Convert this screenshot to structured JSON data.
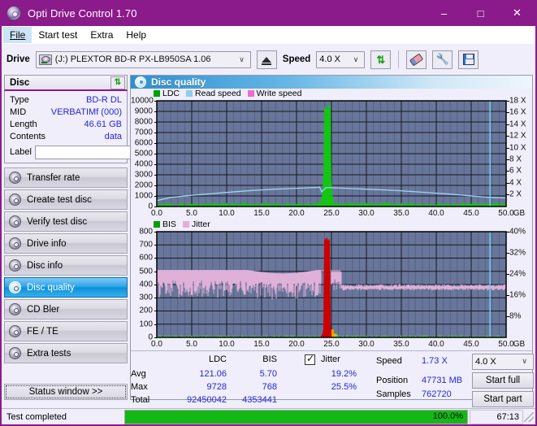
{
  "window": {
    "title": "Opti Drive Control 1.70",
    "icon": "disc-icon",
    "minimize": "–",
    "maximize": "□",
    "close": "✕"
  },
  "menu": [
    {
      "label": "File",
      "active": true
    },
    {
      "label": "Start test",
      "active": false
    },
    {
      "label": "Extra",
      "active": false
    },
    {
      "label": "Help",
      "active": false
    }
  ],
  "toolbar": {
    "drive_label": "Drive",
    "drive_value": "(J:)  PLEXTOR BD-R  PX-LB950SA 1.06",
    "drive_icon": "drive-icon",
    "eject_icon": "eject-icon",
    "speed_label": "Speed",
    "speed_value": "4.0 X",
    "refresh_icon": "refresh-icon",
    "eraser_icon": "eraser-icon",
    "tools_icon": "wrench-icon",
    "save_icon": "save-icon",
    "caret": "∨"
  },
  "disc_panel": {
    "title": "Disc",
    "refresh_icon": "refresh-icon",
    "rows": [
      {
        "key": "Type",
        "value": "BD-R DL"
      },
      {
        "key": "MID",
        "value": "VERBATIMf (000)"
      },
      {
        "key": "Length",
        "value": "46.61 GB"
      },
      {
        "key": "Contents",
        "value": "data"
      }
    ],
    "label_key": "Label",
    "label_value": "",
    "label_placeholder": "",
    "disc_icon": "cd-icon"
  },
  "nav": {
    "items": [
      {
        "label": "Transfer rate",
        "selected": false
      },
      {
        "label": "Create test disc",
        "selected": false
      },
      {
        "label": "Verify test disc",
        "selected": false
      },
      {
        "label": "Drive info",
        "selected": false
      },
      {
        "label": "Disc info",
        "selected": false
      },
      {
        "label": "Disc quality",
        "selected": true
      },
      {
        "label": "CD Bler",
        "selected": false
      },
      {
        "label": "FE / TE",
        "selected": false
      },
      {
        "label": "Extra tests",
        "selected": false
      }
    ],
    "status_window_button": "Status window >>"
  },
  "content": {
    "header_title": "Disc quality",
    "header_icon": "disc-quality-icon"
  },
  "chart_data": [
    {
      "type": "line",
      "name": "top-chart",
      "title": "",
      "xlabel": "GB",
      "ylabel": "",
      "xlim": [
        0,
        50
      ],
      "ylim": [
        0,
        10000
      ],
      "y2lim": [
        0,
        18
      ],
      "y2label": "X",
      "grid": true,
      "legend": [
        {
          "label": "LDC",
          "color": "#00a000"
        },
        {
          "label": "Read speed",
          "color": "#8ccfee"
        },
        {
          "label": "Write speed",
          "color": "#f06bd0"
        }
      ],
      "yticks": [
        0,
        1000,
        2000,
        3000,
        4000,
        5000,
        6000,
        7000,
        8000,
        9000,
        10000
      ],
      "yticklabels": [
        "0",
        "1000",
        "2000",
        "3000",
        "4000",
        "5000",
        "6000",
        "7000",
        "8000",
        "9000",
        "10000"
      ],
      "y2ticks": [
        2,
        4,
        6,
        8,
        10,
        12,
        14,
        16,
        18
      ],
      "y2ticklabels": [
        "2 X",
        "4 X",
        "6 X",
        "8 X",
        "10 X",
        "12 X",
        "14 X",
        "16 X",
        "18 X"
      ],
      "xticks": [
        0,
        5,
        10,
        15,
        20,
        25,
        30,
        35,
        40,
        45,
        50
      ],
      "xticklabels": [
        "0.0",
        "5.0",
        "10.0",
        "15.0",
        "20.0",
        "25.0",
        "30.0",
        "35.0",
        "40.0",
        "45.0",
        "50.0"
      ],
      "xunit": "GB",
      "series": [
        {
          "name": "Read speed",
          "color": "#8ccfee",
          "axis": "right",
          "x": [
            0,
            2,
            5,
            8,
            11,
            14,
            17,
            20,
            23,
            23.3,
            23.6,
            24.2,
            25,
            27,
            30,
            33,
            36,
            39,
            42,
            45,
            47.7,
            50
          ],
          "y": [
            1.0,
            1.55,
            1.9,
            2.2,
            2.5,
            2.75,
            2.95,
            3.1,
            3.25,
            3.3,
            2.5,
            3.2,
            3.2,
            3.1,
            2.95,
            2.8,
            2.6,
            2.35,
            2.1,
            1.8,
            1.55,
            1.45
          ]
        },
        {
          "name": "LDC",
          "color": "#00c000",
          "axis": "left",
          "baseline_noise": [
            60,
            420
          ],
          "spike_center": 24.4,
          "spike_width": 1.1,
          "spike_peak": 9728
        }
      ],
      "marker_line": {
        "x": 47.7,
        "color": "#66d8f0"
      }
    },
    {
      "type": "line",
      "name": "bottom-chart",
      "title": "",
      "xlabel": "GB",
      "xlim": [
        0,
        50
      ],
      "ylim": [
        0,
        800
      ],
      "y2lim": [
        0,
        40
      ],
      "y2label": "%",
      "grid": true,
      "legend": [
        {
          "label": "BIS",
          "color": "#00a000"
        },
        {
          "label": "Jitter",
          "color": "#e0afd8"
        }
      ],
      "yticks": [
        0,
        100,
        200,
        300,
        400,
        500,
        600,
        700,
        800
      ],
      "yticklabels": [
        "0",
        "100",
        "200",
        "300",
        "400",
        "500",
        "600",
        "700",
        "800"
      ],
      "y2ticks": [
        8,
        16,
        24,
        32,
        40
      ],
      "y2ticklabels": [
        "8%",
        "16%",
        "24%",
        "32%",
        "40%"
      ],
      "xticks": [
        0,
        5,
        10,
        15,
        20,
        25,
        30,
        35,
        40,
        45,
        50
      ],
      "xticklabels": [
        "0.0",
        "5.0",
        "10.0",
        "15.0",
        "20.0",
        "25.0",
        "30.0",
        "35.0",
        "40.0",
        "45.0",
        "50.0"
      ],
      "xunit": "GB",
      "series": [
        {
          "name": "Jitter",
          "color": "#dfb0d8",
          "axis": "right",
          "band_top_pct": 25.5,
          "band_low_pct": 15.0,
          "tail_pct": 19.2
        },
        {
          "name": "BIS",
          "color": "#cc0000",
          "axis": "left",
          "baseline": 6,
          "spike_center": 24.4,
          "spike_width": 0.9,
          "spike_peak": 768
        }
      ],
      "marker_line": {
        "x": 47.7,
        "color": "#66d8f0"
      }
    }
  ],
  "stats": {
    "columns": [
      "LDC",
      "BIS",
      "Jitter"
    ],
    "jitter_checked": true,
    "rows": [
      {
        "label": "Avg",
        "ldc": "121.06",
        "bis": "5.70",
        "jitter": "19.2%"
      },
      {
        "label": "Max",
        "ldc": "9728",
        "bis": "768",
        "jitter": "25.5%"
      },
      {
        "label": "Total",
        "ldc": "92450042",
        "bis": "4353441",
        "jitter": ""
      }
    ]
  },
  "test_panel": {
    "speed_label": "Speed",
    "speed_value": "1.73 X",
    "speed_select": "4.0 X",
    "position_label": "Position",
    "position_value": "47731 MB",
    "samples_label": "Samples",
    "samples_value": "762720",
    "start_full_button": "Start full",
    "start_part_button": "Start part",
    "caret": "∨"
  },
  "statusbar": {
    "message": "Test completed",
    "progress_text": "100.0%",
    "progress_value": 100,
    "elapsed": "67:13"
  }
}
